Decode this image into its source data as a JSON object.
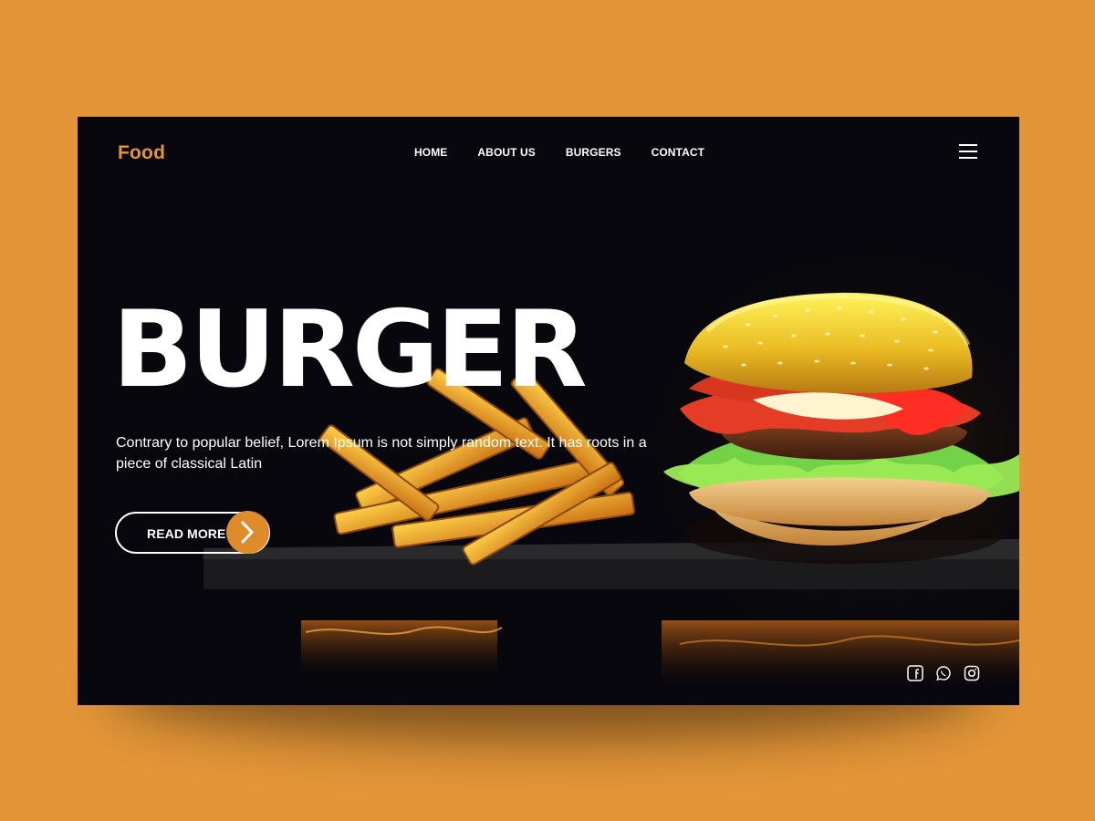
{
  "brand": {
    "name": "Food",
    "accent_color": "#e39537",
    "cta_color": "#e08b2b",
    "background_color": "#07070d"
  },
  "nav": {
    "items": [
      {
        "label": "HOME"
      },
      {
        "label": "ABOUT US"
      },
      {
        "label": "BURGERS"
      },
      {
        "label": "CONTACT"
      }
    ],
    "menu_icon": "hamburger-icon"
  },
  "hero": {
    "title": "BURGER",
    "description": "Contrary to popular belief, Lorem Ipsum is not simply random text. It has roots in a piece of classical Latin",
    "cta_label": "READ MORE",
    "cta_icon": "chevron-right-icon",
    "image": "burger-and-fries-photo"
  },
  "social": [
    {
      "icon": "facebook-icon"
    },
    {
      "icon": "whatsapp-icon"
    },
    {
      "icon": "instagram-icon"
    }
  ]
}
